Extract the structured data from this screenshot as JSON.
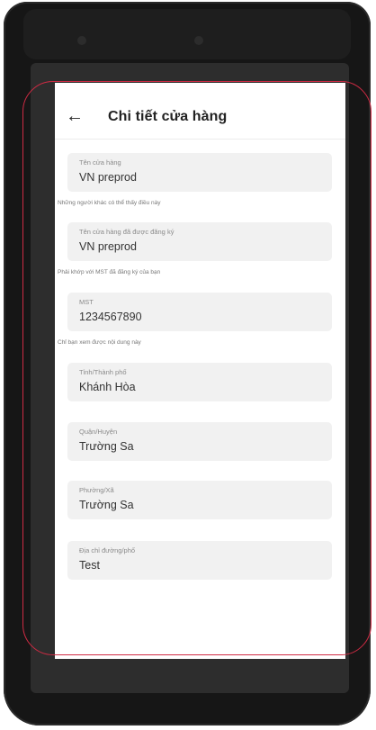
{
  "header": {
    "back_icon": "arrow-left-icon",
    "title": "Chi tiết cửa hàng"
  },
  "fields": [
    {
      "label": "Tên cửa hàng",
      "value": "VN preprod",
      "helper": "Những người khác có thể thấy điều này"
    },
    {
      "label": "Tên cửa hàng đã được đăng ký",
      "value": "VN preprod",
      "helper": "Phải khớp với MST đã đăng ký của bạn"
    },
    {
      "label": "MST",
      "value": "1234567890",
      "helper": "Chỉ bạn xem được nội dung này"
    },
    {
      "label": "Tỉnh/Thành phố",
      "value": "Khánh Hòa"
    },
    {
      "label": "Quận/Huyện",
      "value": "Trường Sa"
    },
    {
      "label": "Phường/Xã",
      "value": "Trường Sa"
    },
    {
      "label": "Địa chỉ đường/phố",
      "value": "Test"
    }
  ],
  "colors": {
    "outline": "#d02b44",
    "field_bg": "#f1f1f1",
    "phone_body": "#161616"
  }
}
